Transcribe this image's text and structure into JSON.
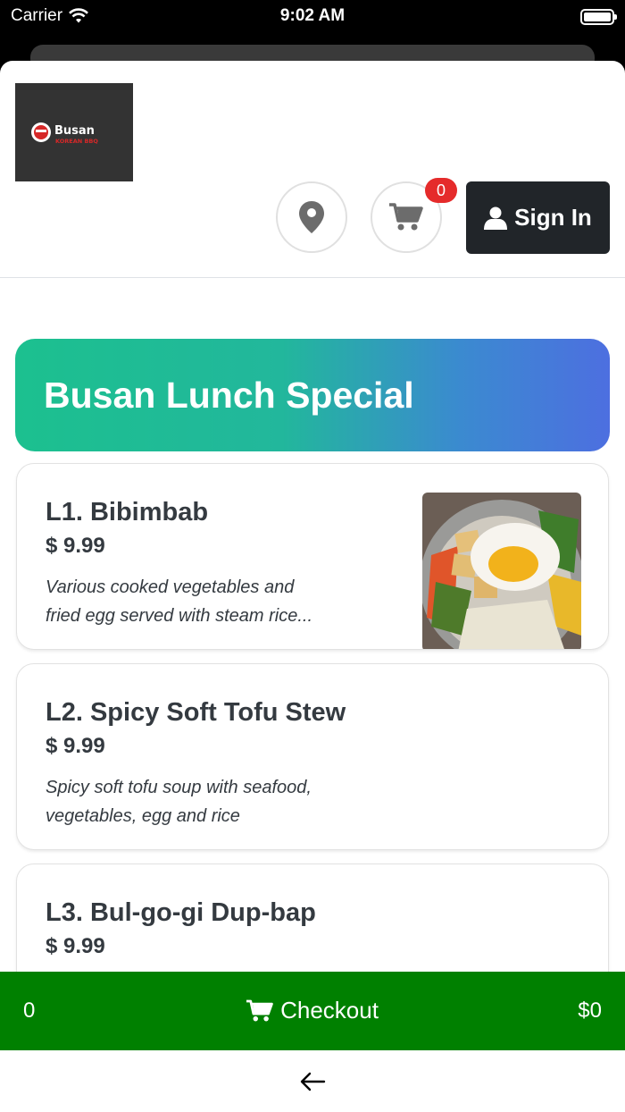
{
  "status_bar": {
    "carrier": "Carrier",
    "time": "9:02 AM"
  },
  "header": {
    "logo_text": "BUSAN",
    "logo_subtext": "KOREAN BBQ",
    "cart_count": "0",
    "signin_label": "Sign In"
  },
  "section": {
    "title": "Busan Lunch Special"
  },
  "items": [
    {
      "name": "L1. Bibimbab",
      "price": "$ 9.99",
      "desc_line1": "Various cooked vegetables and",
      "desc_line2": "fried egg served with steam rice..."
    },
    {
      "name": "L2. Spicy Soft Tofu Stew",
      "price": "$ 9.99",
      "desc_line1": "Spicy soft tofu soup with seafood,",
      "desc_line2": "vegetables, egg and rice"
    },
    {
      "name": "L3. Bul-go-gi Dup-bap",
      "price": "$ 9.99"
    }
  ],
  "checkout": {
    "count": "0",
    "label": "Checkout",
    "total": "$0"
  },
  "colors": {
    "accent_green": "#008000",
    "badge_red": "#e52b2b",
    "banner_start": "#1cc08f",
    "banner_end": "#4d6fe0"
  }
}
